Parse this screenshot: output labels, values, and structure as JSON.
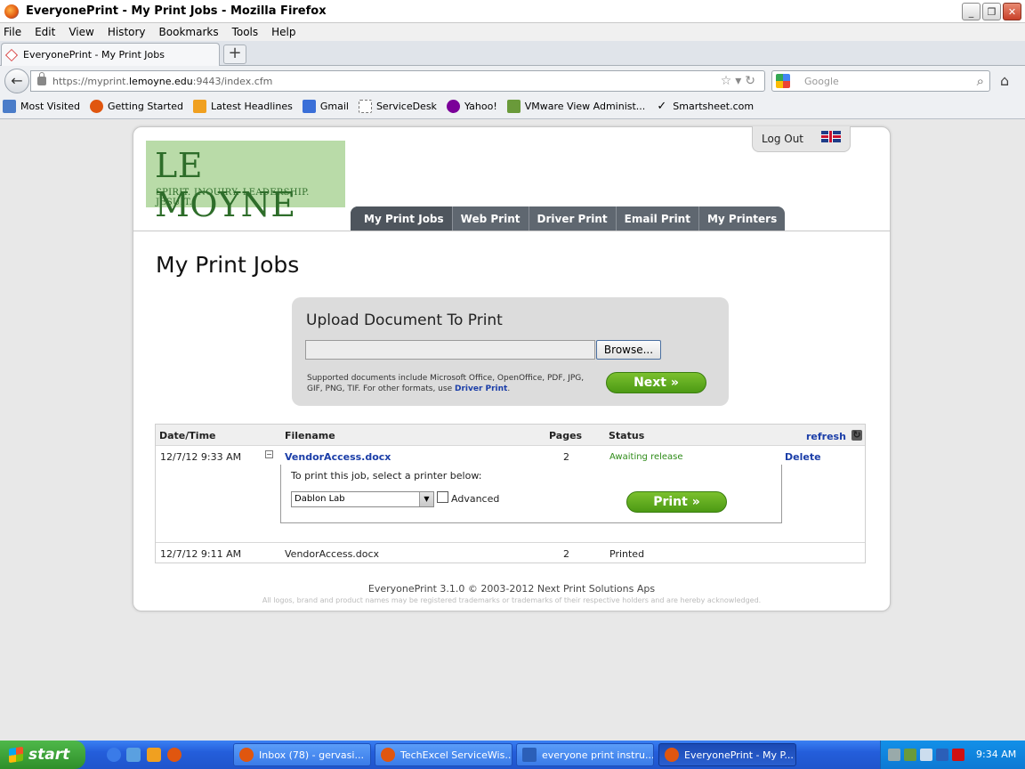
{
  "window": {
    "title": "EveryonePrint - My Print Jobs - Mozilla Firefox",
    "buttons": {
      "minimize": "_",
      "restore": "❐",
      "close": "✕"
    }
  },
  "menu": [
    "File",
    "Edit",
    "View",
    "History",
    "Bookmarks",
    "Tools",
    "Help"
  ],
  "browser": {
    "tab_label": "EveryonePrint - My Print Jobs",
    "newtab_label": "+",
    "url_prefix": "https://myprint.",
    "url_domain": "lemoyne.edu",
    "url_suffix": ":9443/index.cfm",
    "search_placeholder": "Google"
  },
  "bookmarks": [
    {
      "label": "Most Visited",
      "icon": "most-visited-icon",
      "color": "#4a7cc9"
    },
    {
      "label": "Getting Started",
      "icon": "firefox-icon",
      "color": "#e0560f"
    },
    {
      "label": "Latest Headlines",
      "icon": "rss-icon",
      "color": "#f0a020"
    },
    {
      "label": "Gmail",
      "icon": "google-icon",
      "color": "#3a6fd8"
    },
    {
      "label": "ServiceDesk",
      "icon": "page-icon",
      "color": "#ffffff"
    },
    {
      "label": "Yahoo!",
      "icon": "yahoo-icon",
      "color": "#7b0099"
    },
    {
      "label": "VMware View Administ...",
      "icon": "vmware-icon",
      "color": "#6a9a3a"
    },
    {
      "label": "Smartsheet.com",
      "icon": "checkmark-icon",
      "color": "#ffffff"
    }
  ],
  "page": {
    "logout": "Log Out",
    "logo_name": "LE MOYNE",
    "logo_tagline": "SPIRIT. INQUIRY. LEADERSHIP. JESUIT.",
    "nav": [
      "My Print Jobs",
      "Web Print",
      "Driver Print",
      "Email Print",
      "My Printers"
    ],
    "title": "My Print Jobs",
    "upload": {
      "title": "Upload Document To Print",
      "browse": "Browse...",
      "supported_text": "Supported documents include Microsoft Office, OpenOffice, PDF, JPG, GIF, PNG, TIF. For other formats, use ",
      "driver_print_link": "Driver Print",
      "period": ".",
      "next": "Next »"
    },
    "table": {
      "headers": {
        "datetime": "Date/Time",
        "filename": "Filename",
        "pages": "Pages",
        "status": "Status",
        "refresh": "refresh"
      },
      "rows": [
        {
          "datetime": "12/7/12 9:33 AM",
          "filename": "VendorAccess.docx",
          "pages": "2",
          "status": "Awaiting release",
          "action": "Delete"
        },
        {
          "datetime": "12/7/12 9:11 AM",
          "filename": "VendorAccess.docx",
          "pages": "2",
          "status": "Printed"
        }
      ],
      "expand": {
        "prompt": "To print this job, select a printer below:",
        "printer": "Dablon Lab",
        "advanced": "Advanced",
        "print": "Print »"
      }
    },
    "footer": "EveryonePrint 3.1.0 © 2003-2012 Next Print Solutions Aps",
    "footer_small": "All logos, brand and product names may be registered trademarks or trademarks of their respective holders and are hereby acknowledged."
  },
  "taskbar": {
    "start": "start",
    "items": [
      {
        "label": "Inbox (78) - gervasi...",
        "color": "#e0560f"
      },
      {
        "label": "TechExcel ServiceWis...",
        "color": "#e0560f"
      },
      {
        "label": "everyone print instru...",
        "color": "#2b5fb8"
      },
      {
        "label": "EveryonePrint - My P...",
        "color": "#e0560f"
      }
    ],
    "clock": "9:34 AM"
  }
}
